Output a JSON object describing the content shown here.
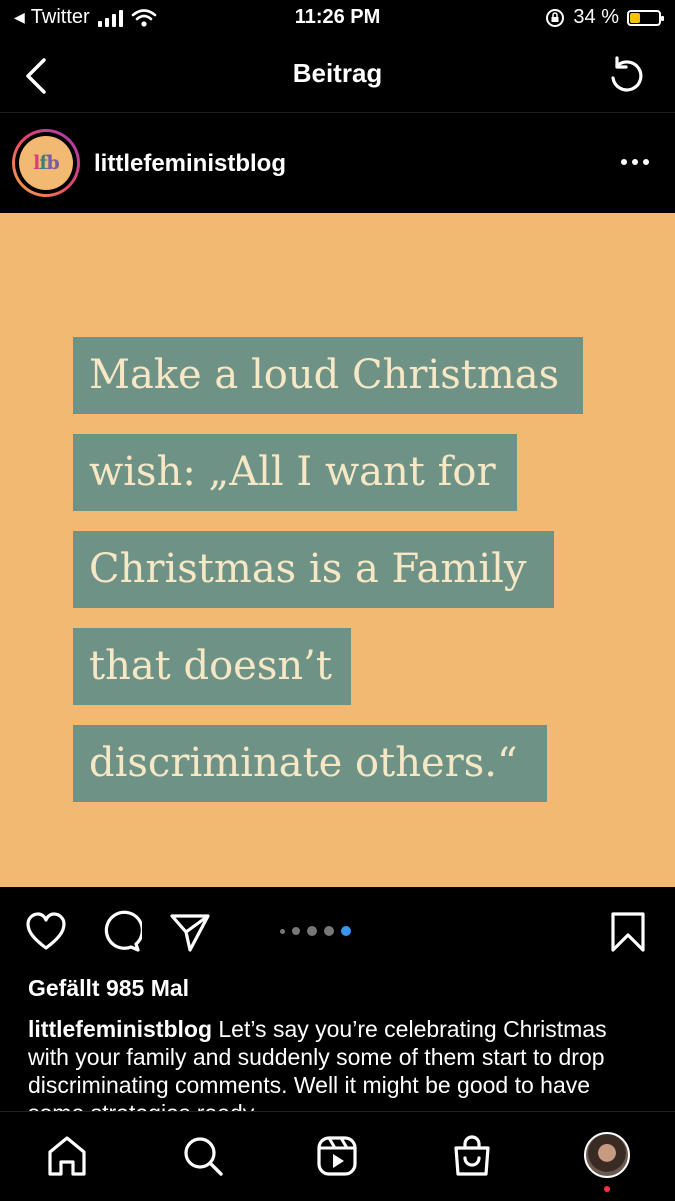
{
  "status_bar": {
    "back_app": "Twitter",
    "time": "11:26 PM",
    "battery": "34 %",
    "battery_level": 0.34
  },
  "nav": {
    "title": "Beitrag"
  },
  "post": {
    "username": "littlefeministblog",
    "avatar_text": [
      "l",
      "f",
      "b"
    ],
    "image_lines": [
      "Make a loud Christmas",
      "wish: „All I want for",
      "Christmas is a Family",
      "that doesn’t",
      "discriminate others.“"
    ],
    "carousel": {
      "count": 5,
      "active_index": 4
    },
    "likes": "Gefällt 985 Mal",
    "caption_user": "littlefeministblog",
    "caption_text": "Let’s say you’re celebrating Christmas with your family and suddenly some of them start to drop discriminating comments. Well it might be good to have some strategies ready..."
  },
  "colors": {
    "image_bg": "#f2b973",
    "text_block": "#6f9287",
    "quote_text": "#f7e8c5",
    "active_dot": "#3897f0",
    "notification": "#ff3040"
  },
  "icons": [
    "back-icon",
    "refresh-icon",
    "more-icon",
    "heart-icon",
    "comment-icon",
    "share-icon",
    "bookmark-icon",
    "home-icon",
    "search-icon",
    "reels-icon",
    "shop-icon"
  ]
}
